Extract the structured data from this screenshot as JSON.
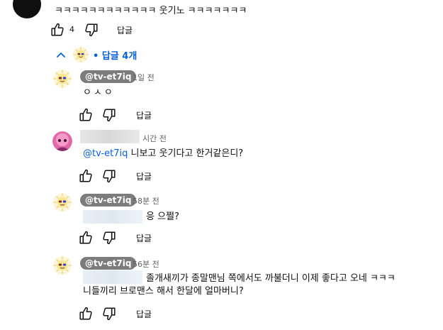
{
  "top_comment": {
    "text": "ㅋㅋㅋㅋㅋㅋㅋㅋㅋㅋㅋㅋ 웃기노 ㅋㅋㅋㅋㅋㅋㅋ",
    "likes": "4",
    "reply_label": "답글"
  },
  "replies_toggle": {
    "label": "• 답글 4개"
  },
  "replies": [
    {
      "handle": "@tv-et7iq",
      "time": "1일 전",
      "text": "ㅇㅅㅇ",
      "reply_label": "답글"
    },
    {
      "handle": "",
      "time": "시간 전",
      "mention": "@tv-et7iq",
      "text": " 니보고 웃기다고 한거같은디?",
      "reply_label": "답글"
    },
    {
      "handle": "@tv-et7iq",
      "time": "58분 전",
      "text": "응 으쩔?",
      "reply_label": "답글"
    },
    {
      "handle": "@tv-et7iq",
      "time": "56분 전",
      "text_line1": "졸개새끼가 종말맨님 쪽에서도 까불더니 이제 좋다고 오네 ㅋㅋㅋ",
      "text_line2": "니들끼리 브로맨스 해서 한달에 얼마버니?",
      "reply_label": "답글"
    }
  ],
  "colors": {
    "link": "#065fd4",
    "chip": "#7c7c7c",
    "secondary_text": "#606060"
  }
}
